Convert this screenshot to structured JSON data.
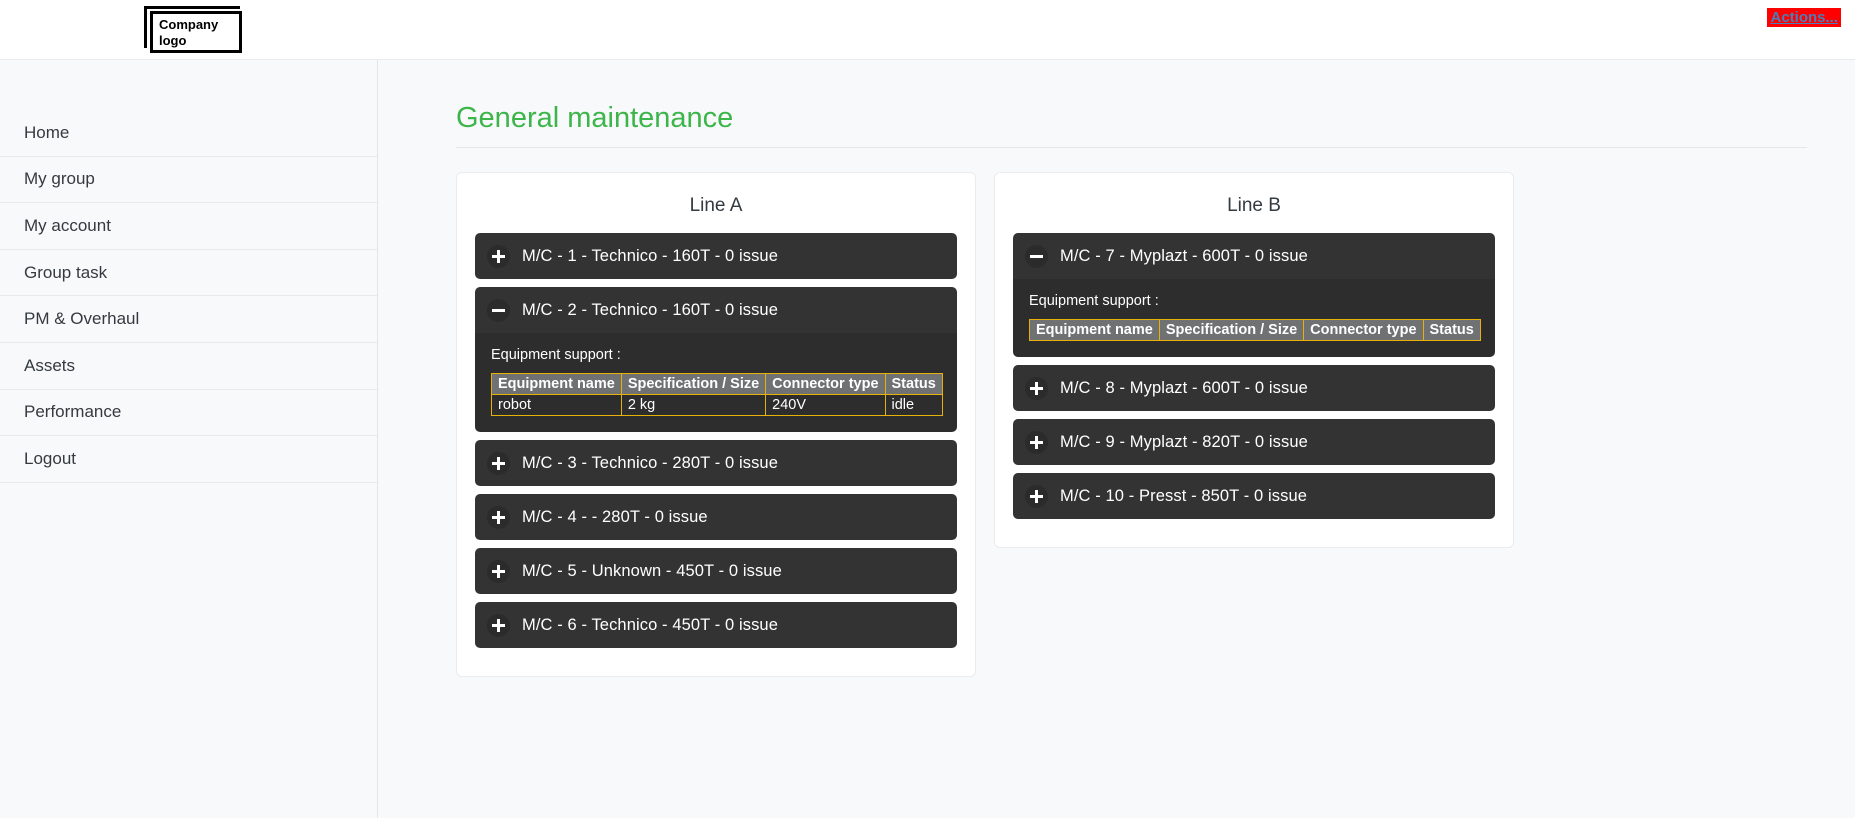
{
  "topbar": {
    "logo_line1": "Company",
    "logo_line2": "logo",
    "actions_label": "Actions...",
    "actions_color": "#ff0000",
    "actions_text_color": "#4a7ebb"
  },
  "sidebar": {
    "items": [
      {
        "label": "Home"
      },
      {
        "label": "My group"
      },
      {
        "label": "My account"
      },
      {
        "label": "Group task"
      },
      {
        "label": "PM & Overhaul"
      },
      {
        "label": "Assets"
      },
      {
        "label": "Performance"
      },
      {
        "label": "Logout"
      }
    ]
  },
  "main": {
    "page_title": "General maintenance",
    "title_color": "#3cb54a",
    "panel_caption": "Equipment support :",
    "table_headers": [
      "Equipment name",
      "Specification / Size",
      "Connector type",
      "Status"
    ],
    "lines": [
      {
        "title": "Line A",
        "machines": [
          {
            "label": "M/C - 1 - Technico - 160T   -   0   issue",
            "expanded": false,
            "icon": "plus-icon",
            "rows": []
          },
          {
            "label": "M/C - 2 - Technico - 160T   -   0   issue",
            "expanded": true,
            "icon": "minus-icon",
            "rows": [
              [
                "robot",
                "2 kg",
                "240V",
                "idle"
              ]
            ]
          },
          {
            "label": "M/C - 3 - Technico - 280T   -   0   issue",
            "expanded": false,
            "icon": "plus-icon",
            "rows": []
          },
          {
            "label": "M/C - 4 - - 280T   -   0   issue",
            "expanded": false,
            "icon": "plus-icon",
            "rows": []
          },
          {
            "label": "M/C - 5 - Unknown - 450T   -   0   issue",
            "expanded": false,
            "icon": "plus-icon",
            "rows": []
          },
          {
            "label": "M/C - 6 - Technico - 450T   -   0   issue",
            "expanded": false,
            "icon": "plus-icon",
            "rows": []
          }
        ]
      },
      {
        "title": "Line B",
        "machines": [
          {
            "label": "M/C - 7 - Myplazt - 600T   -   0   issue",
            "expanded": true,
            "icon": "minus-icon",
            "rows": []
          },
          {
            "label": "M/C - 8 - Myplazt - 600T   -   0   issue",
            "expanded": false,
            "icon": "plus-icon",
            "rows": []
          },
          {
            "label": "M/C - 9 - Myplazt - 820T   -   0   issue",
            "expanded": false,
            "icon": "plus-icon",
            "rows": []
          },
          {
            "label": "M/C - 10 - Presst - 850T   -   0   issue",
            "expanded": false,
            "icon": "plus-icon",
            "rows": []
          }
        ]
      }
    ]
  }
}
